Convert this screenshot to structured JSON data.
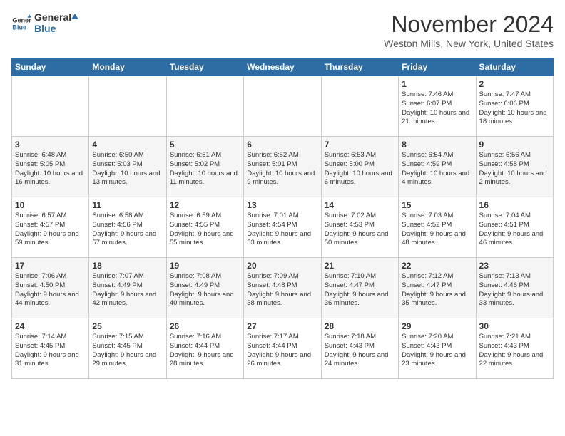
{
  "header": {
    "logo_general": "General",
    "logo_blue": "Blue",
    "title": "November 2024",
    "subtitle": "Weston Mills, New York, United States"
  },
  "columns": [
    "Sunday",
    "Monday",
    "Tuesday",
    "Wednesday",
    "Thursday",
    "Friday",
    "Saturday"
  ],
  "weeks": [
    [
      {
        "day": "",
        "info": ""
      },
      {
        "day": "",
        "info": ""
      },
      {
        "day": "",
        "info": ""
      },
      {
        "day": "",
        "info": ""
      },
      {
        "day": "",
        "info": ""
      },
      {
        "day": "1",
        "info": "Sunrise: 7:46 AM\nSunset: 6:07 PM\nDaylight: 10 hours and 21 minutes."
      },
      {
        "day": "2",
        "info": "Sunrise: 7:47 AM\nSunset: 6:06 PM\nDaylight: 10 hours and 18 minutes."
      }
    ],
    [
      {
        "day": "3",
        "info": "Sunrise: 6:48 AM\nSunset: 5:05 PM\nDaylight: 10 hours and 16 minutes."
      },
      {
        "day": "4",
        "info": "Sunrise: 6:50 AM\nSunset: 5:03 PM\nDaylight: 10 hours and 13 minutes."
      },
      {
        "day": "5",
        "info": "Sunrise: 6:51 AM\nSunset: 5:02 PM\nDaylight: 10 hours and 11 minutes."
      },
      {
        "day": "6",
        "info": "Sunrise: 6:52 AM\nSunset: 5:01 PM\nDaylight: 10 hours and 9 minutes."
      },
      {
        "day": "7",
        "info": "Sunrise: 6:53 AM\nSunset: 5:00 PM\nDaylight: 10 hours and 6 minutes."
      },
      {
        "day": "8",
        "info": "Sunrise: 6:54 AM\nSunset: 4:59 PM\nDaylight: 10 hours and 4 minutes."
      },
      {
        "day": "9",
        "info": "Sunrise: 6:56 AM\nSunset: 4:58 PM\nDaylight: 10 hours and 2 minutes."
      }
    ],
    [
      {
        "day": "10",
        "info": "Sunrise: 6:57 AM\nSunset: 4:57 PM\nDaylight: 9 hours and 59 minutes."
      },
      {
        "day": "11",
        "info": "Sunrise: 6:58 AM\nSunset: 4:56 PM\nDaylight: 9 hours and 57 minutes."
      },
      {
        "day": "12",
        "info": "Sunrise: 6:59 AM\nSunset: 4:55 PM\nDaylight: 9 hours and 55 minutes."
      },
      {
        "day": "13",
        "info": "Sunrise: 7:01 AM\nSunset: 4:54 PM\nDaylight: 9 hours and 53 minutes."
      },
      {
        "day": "14",
        "info": "Sunrise: 7:02 AM\nSunset: 4:53 PM\nDaylight: 9 hours and 50 minutes."
      },
      {
        "day": "15",
        "info": "Sunrise: 7:03 AM\nSunset: 4:52 PM\nDaylight: 9 hours and 48 minutes."
      },
      {
        "day": "16",
        "info": "Sunrise: 7:04 AM\nSunset: 4:51 PM\nDaylight: 9 hours and 46 minutes."
      }
    ],
    [
      {
        "day": "17",
        "info": "Sunrise: 7:06 AM\nSunset: 4:50 PM\nDaylight: 9 hours and 44 minutes."
      },
      {
        "day": "18",
        "info": "Sunrise: 7:07 AM\nSunset: 4:49 PM\nDaylight: 9 hours and 42 minutes."
      },
      {
        "day": "19",
        "info": "Sunrise: 7:08 AM\nSunset: 4:49 PM\nDaylight: 9 hours and 40 minutes."
      },
      {
        "day": "20",
        "info": "Sunrise: 7:09 AM\nSunset: 4:48 PM\nDaylight: 9 hours and 38 minutes."
      },
      {
        "day": "21",
        "info": "Sunrise: 7:10 AM\nSunset: 4:47 PM\nDaylight: 9 hours and 36 minutes."
      },
      {
        "day": "22",
        "info": "Sunrise: 7:12 AM\nSunset: 4:47 PM\nDaylight: 9 hours and 35 minutes."
      },
      {
        "day": "23",
        "info": "Sunrise: 7:13 AM\nSunset: 4:46 PM\nDaylight: 9 hours and 33 minutes."
      }
    ],
    [
      {
        "day": "24",
        "info": "Sunrise: 7:14 AM\nSunset: 4:45 PM\nDaylight: 9 hours and 31 minutes."
      },
      {
        "day": "25",
        "info": "Sunrise: 7:15 AM\nSunset: 4:45 PM\nDaylight: 9 hours and 29 minutes."
      },
      {
        "day": "26",
        "info": "Sunrise: 7:16 AM\nSunset: 4:44 PM\nDaylight: 9 hours and 28 minutes."
      },
      {
        "day": "27",
        "info": "Sunrise: 7:17 AM\nSunset: 4:44 PM\nDaylight: 9 hours and 26 minutes."
      },
      {
        "day": "28",
        "info": "Sunrise: 7:18 AM\nSunset: 4:43 PM\nDaylight: 9 hours and 24 minutes."
      },
      {
        "day": "29",
        "info": "Sunrise: 7:20 AM\nSunset: 4:43 PM\nDaylight: 9 hours and 23 minutes."
      },
      {
        "day": "30",
        "info": "Sunrise: 7:21 AM\nSunset: 4:43 PM\nDaylight: 9 hours and 22 minutes."
      }
    ]
  ]
}
